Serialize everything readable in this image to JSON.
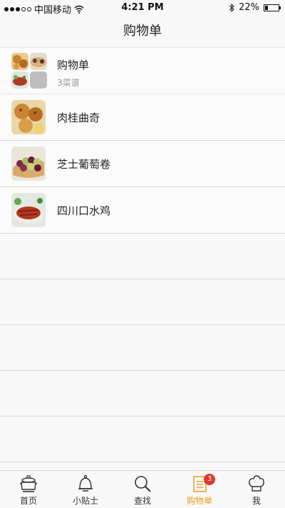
{
  "status_bar": {
    "carrier": "中国移动",
    "time": "4:21 PM",
    "battery": "22%",
    "battery_level": 0.22
  },
  "nav": {
    "title": "购物单"
  },
  "summary": {
    "title": "购物单",
    "subtitle": "3菜谱"
  },
  "recipes": [
    {
      "name": "肉桂曲奇",
      "thumb": "cookie-thumbnail"
    },
    {
      "name": "芝士葡萄卷",
      "thumb": "grape-roll-thumbnail"
    },
    {
      "name": "四川口水鸡",
      "thumb": "chicken-thumbnail"
    }
  ],
  "tabs": [
    {
      "label": "首页",
      "icon": "pot-icon"
    },
    {
      "label": "小贴士",
      "icon": "bell-icon"
    },
    {
      "label": "查找",
      "icon": "search-icon"
    },
    {
      "label": "购物单",
      "icon": "list-icon",
      "active": true,
      "badge": "3"
    },
    {
      "label": "我",
      "icon": "chef-hat-icon"
    }
  ],
  "colors": {
    "accent": "#e8a11d",
    "badge": "#e2382d"
  }
}
